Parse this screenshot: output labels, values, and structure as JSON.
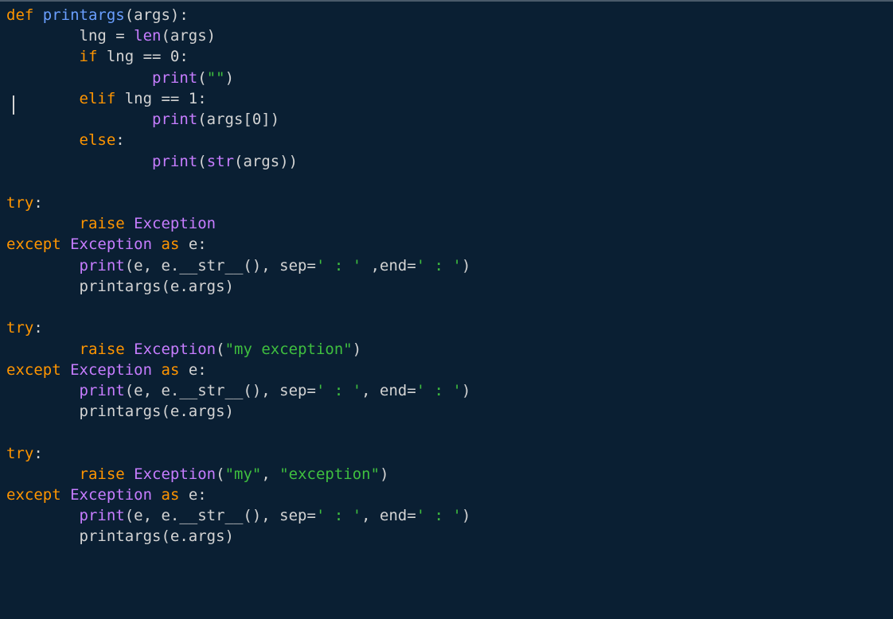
{
  "code": {
    "lines": [
      [
        {
          "cls": "kw",
          "text": "def"
        },
        {
          "cls": "id",
          "text": " "
        },
        {
          "cls": "fn-def",
          "text": "printargs"
        },
        {
          "cls": "id",
          "text": "(args):"
        }
      ],
      [
        {
          "cls": "id",
          "text": "        lng = "
        },
        {
          "cls": "builtin",
          "text": "len"
        },
        {
          "cls": "id",
          "text": "(args)"
        }
      ],
      [
        {
          "cls": "id",
          "text": "        "
        },
        {
          "cls": "kw",
          "text": "if"
        },
        {
          "cls": "id",
          "text": " lng == 0:"
        }
      ],
      [
        {
          "cls": "id",
          "text": "                "
        },
        {
          "cls": "builtin",
          "text": "print"
        },
        {
          "cls": "id",
          "text": "("
        },
        {
          "cls": "str",
          "text": "\"\""
        },
        {
          "cls": "id",
          "text": ")"
        }
      ],
      [
        {
          "cls": "id",
          "text": "        "
        },
        {
          "cls": "kw",
          "text": "elif"
        },
        {
          "cls": "id",
          "text": " lng == 1:"
        }
      ],
      [
        {
          "cls": "id",
          "text": "                "
        },
        {
          "cls": "builtin",
          "text": "print"
        },
        {
          "cls": "id",
          "text": "(args[0])"
        }
      ],
      [
        {
          "cls": "id",
          "text": "        "
        },
        {
          "cls": "kw",
          "text": "else"
        },
        {
          "cls": "id",
          "text": ":"
        }
      ],
      [
        {
          "cls": "id",
          "text": "                "
        },
        {
          "cls": "builtin",
          "text": "print"
        },
        {
          "cls": "id",
          "text": "("
        },
        {
          "cls": "builtin",
          "text": "str"
        },
        {
          "cls": "id",
          "text": "(args))"
        }
      ],
      [
        {
          "cls": "id",
          "text": ""
        }
      ],
      [
        {
          "cls": "kw",
          "text": "try"
        },
        {
          "cls": "id",
          "text": ":"
        }
      ],
      [
        {
          "cls": "id",
          "text": "        "
        },
        {
          "cls": "kw",
          "text": "raise"
        },
        {
          "cls": "id",
          "text": " "
        },
        {
          "cls": "builtin",
          "text": "Exception"
        }
      ],
      [
        {
          "cls": "kw",
          "text": "except"
        },
        {
          "cls": "id",
          "text": " "
        },
        {
          "cls": "builtin",
          "text": "Exception"
        },
        {
          "cls": "id",
          "text": " "
        },
        {
          "cls": "kw",
          "text": "as"
        },
        {
          "cls": "id",
          "text": " e:"
        }
      ],
      [
        {
          "cls": "id",
          "text": "        "
        },
        {
          "cls": "builtin",
          "text": "print"
        },
        {
          "cls": "id",
          "text": "(e, e.__str__(), sep="
        },
        {
          "cls": "str",
          "text": "' : '"
        },
        {
          "cls": "id",
          "text": " ,end="
        },
        {
          "cls": "str",
          "text": "' : '"
        },
        {
          "cls": "id",
          "text": ")"
        }
      ],
      [
        {
          "cls": "id",
          "text": "        printargs(e.args)"
        }
      ],
      [
        {
          "cls": "id",
          "text": ""
        }
      ],
      [
        {
          "cls": "kw",
          "text": "try"
        },
        {
          "cls": "id",
          "text": ":"
        }
      ],
      [
        {
          "cls": "id",
          "text": "        "
        },
        {
          "cls": "kw",
          "text": "raise"
        },
        {
          "cls": "id",
          "text": " "
        },
        {
          "cls": "builtin",
          "text": "Exception"
        },
        {
          "cls": "id",
          "text": "("
        },
        {
          "cls": "str",
          "text": "\"my exception\""
        },
        {
          "cls": "id",
          "text": ")"
        }
      ],
      [
        {
          "cls": "kw",
          "text": "except"
        },
        {
          "cls": "id",
          "text": " "
        },
        {
          "cls": "builtin",
          "text": "Exception"
        },
        {
          "cls": "id",
          "text": " "
        },
        {
          "cls": "kw",
          "text": "as"
        },
        {
          "cls": "id",
          "text": " e:"
        }
      ],
      [
        {
          "cls": "id",
          "text": "        "
        },
        {
          "cls": "builtin",
          "text": "print"
        },
        {
          "cls": "id",
          "text": "(e, e.__str__(), sep="
        },
        {
          "cls": "str",
          "text": "' : '"
        },
        {
          "cls": "id",
          "text": ", end="
        },
        {
          "cls": "str",
          "text": "' : '"
        },
        {
          "cls": "id",
          "text": ")"
        }
      ],
      [
        {
          "cls": "id",
          "text": "        printargs(e.args)"
        }
      ],
      [
        {
          "cls": "id",
          "text": ""
        }
      ],
      [
        {
          "cls": "kw",
          "text": "try"
        },
        {
          "cls": "id",
          "text": ":"
        }
      ],
      [
        {
          "cls": "id",
          "text": "        "
        },
        {
          "cls": "kw",
          "text": "raise"
        },
        {
          "cls": "id",
          "text": " "
        },
        {
          "cls": "builtin",
          "text": "Exception"
        },
        {
          "cls": "id",
          "text": "("
        },
        {
          "cls": "str",
          "text": "\"my\""
        },
        {
          "cls": "id",
          "text": ", "
        },
        {
          "cls": "str",
          "text": "\"exception\""
        },
        {
          "cls": "id",
          "text": ")"
        }
      ],
      [
        {
          "cls": "kw",
          "text": "except"
        },
        {
          "cls": "id",
          "text": " "
        },
        {
          "cls": "builtin",
          "text": "Exception"
        },
        {
          "cls": "id",
          "text": " "
        },
        {
          "cls": "kw",
          "text": "as"
        },
        {
          "cls": "id",
          "text": " e:"
        }
      ],
      [
        {
          "cls": "id",
          "text": "        "
        },
        {
          "cls": "builtin",
          "text": "print"
        },
        {
          "cls": "id",
          "text": "(e, e.__str__(), sep="
        },
        {
          "cls": "str",
          "text": "' : '"
        },
        {
          "cls": "id",
          "text": ", end="
        },
        {
          "cls": "str",
          "text": "' : '"
        },
        {
          "cls": "id",
          "text": ")"
        }
      ],
      [
        {
          "cls": "id",
          "text": "        printargs(e.args)"
        }
      ]
    ]
  },
  "cursor": {
    "line": 4,
    "col": 0
  }
}
